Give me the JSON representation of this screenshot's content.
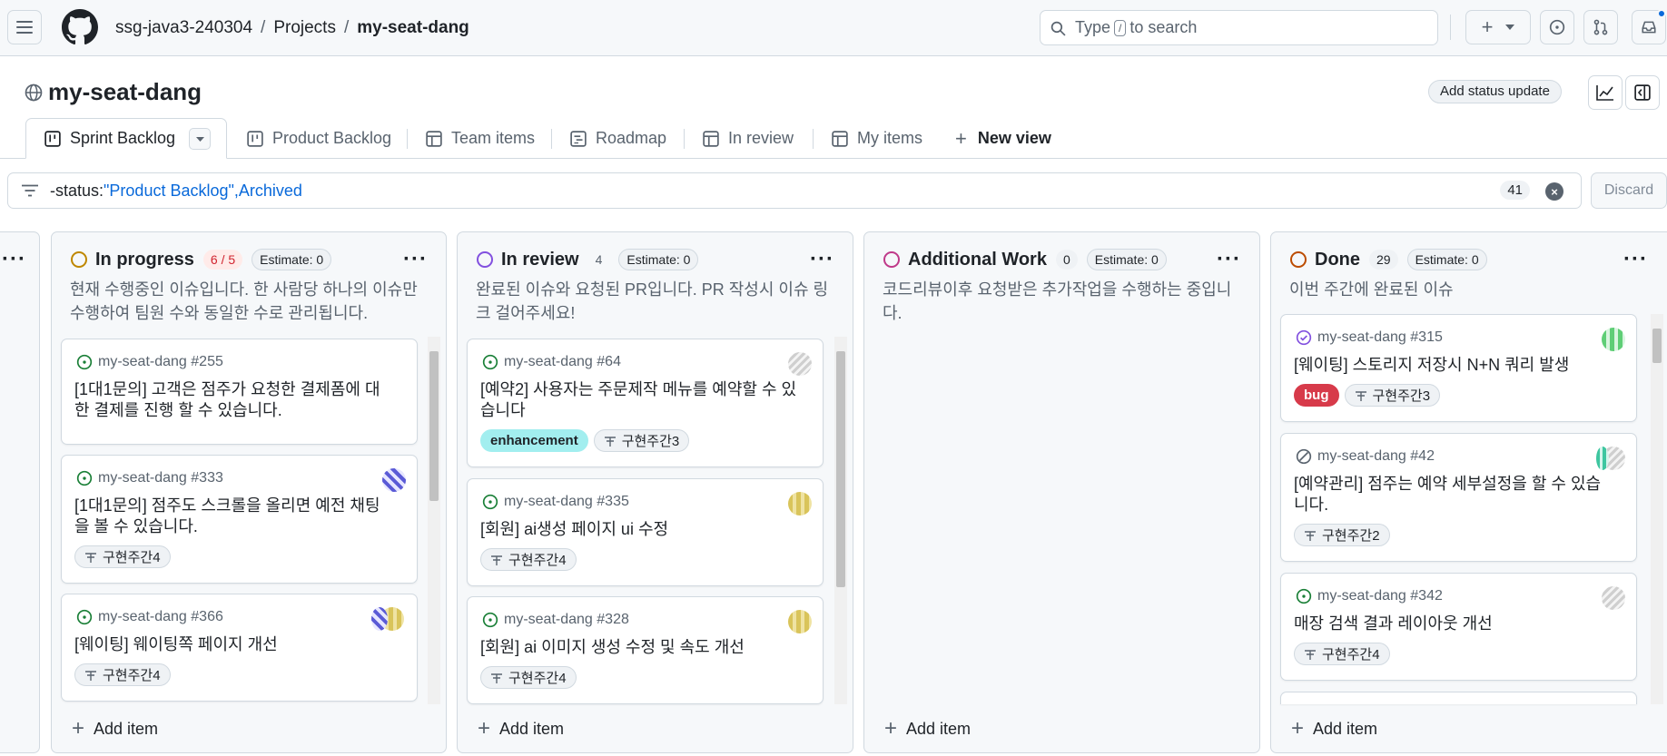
{
  "header": {
    "org": "ssg-java3-240304",
    "projects": "Projects",
    "repo": "my-seat-dang",
    "search_prefix": "Type",
    "search_key": "/",
    "search_suffix": "to search"
  },
  "project": {
    "title": "my-seat-dang",
    "status_button": "Add status update"
  },
  "tabs": [
    {
      "label": "Sprint Backlog"
    },
    {
      "label": "Product Backlog"
    },
    {
      "label": "Team items"
    },
    {
      "label": "Roadmap"
    },
    {
      "label": "In review"
    },
    {
      "label": "My items"
    },
    {
      "label": "New view"
    }
  ],
  "filter": {
    "query_prefix": "-status:",
    "query_value": "\"Product Backlog\",Archived",
    "count": "41",
    "discard": "Discard"
  },
  "columns": [
    {
      "name": "In progress",
      "count": "6 / 5",
      "estimate": "Estimate: 0",
      "description": "현재 수행중인 이슈입니다. 한 사람당 하나의 이슈만 수행하여 팀원 수와 동일한 수로 관리됩니다.",
      "add": "Add item",
      "cards": [
        {
          "ref": "my-seat-dang #255",
          "title": "[1대1문의] 고객은 점주가 요청한 결제폼에 대한 결제를 진행 할 수 있습니다.",
          "tags": []
        },
        {
          "ref": "my-seat-dang #333",
          "title": "[1대1문의] 점주도 스크롤을 올리면 예전 채팅을 볼 수 있습니다.",
          "tags": [
            "구현주간4"
          ]
        },
        {
          "ref": "my-seat-dang #366",
          "title": "[웨이팅] 웨이팅쪽 페이지 개선",
          "tags": [
            "구현주간4"
          ]
        }
      ]
    },
    {
      "name": "In review",
      "count": "4",
      "estimate": "Estimate: 0",
      "description": "완료된 이슈와 요청된 PR입니다. PR 작성시 이슈 링크 걸어주세요!",
      "add": "Add item",
      "cards": [
        {
          "ref": "my-seat-dang #64",
          "title": "[예약2] 사용자는 주문제작 메뉴를 예약할 수 있습니다",
          "tags": [
            "enhancement",
            "구현주간3"
          ]
        },
        {
          "ref": "my-seat-dang #335",
          "title": "[회원] ai생성 페이지 ui 수정",
          "tags": [
            "구현주간4"
          ]
        },
        {
          "ref": "my-seat-dang #328",
          "title": "[회원] ai 이미지 생성 수정 및 속도 개선",
          "tags": [
            "구현주간4"
          ]
        }
      ]
    },
    {
      "name": "Additional Work",
      "count": "0",
      "estimate": "Estimate: 0",
      "description": "코드리뷰이후 요청받은 추가작업을 수행하는 중입니다.",
      "add": "Add item",
      "cards": []
    },
    {
      "name": "Done",
      "count": "29",
      "estimate": "Estimate: 0",
      "description": "이번 주간에 완료된 이슈",
      "add": "Add item",
      "cards": [
        {
          "ref": "my-seat-dang #315",
          "title": "[웨이팅] 스토리지 저장시 N+N 쿼리 발생",
          "tags": [
            "bug",
            "구현주간3"
          ]
        },
        {
          "ref": "my-seat-dang #42",
          "title": "[예약관리] 점주는 예약 세부설정을 할 수 있습니다.",
          "tags": [
            "구현주간2"
          ]
        },
        {
          "ref": "my-seat-dang #342",
          "title": "매장 검색 결과 레이아웃 개선",
          "tags": [
            "구현주간4"
          ]
        }
      ]
    }
  ]
}
